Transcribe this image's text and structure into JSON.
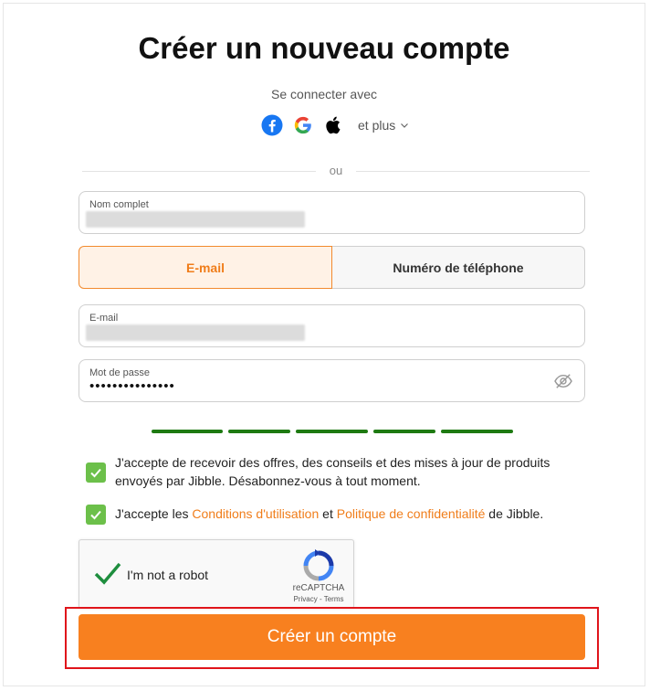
{
  "title": "Créer un nouveau compte",
  "social": {
    "connect_label": "Se connecter avec",
    "providers": [
      {
        "name": "Facebook",
        "icon": "facebook-icon",
        "color": "#1877F2"
      },
      {
        "name": "Google",
        "icon": "google-icon"
      },
      {
        "name": "Apple",
        "icon": "apple-icon",
        "color": "#000000"
      }
    ],
    "more_label": "et plus"
  },
  "divider_label": "ou",
  "full_name_field": {
    "label": "Nom complet"
  },
  "tabs": {
    "email_label": "E-mail",
    "phone_label": "Numéro de téléphone",
    "active": "email"
  },
  "email_field": {
    "label": "E-mail"
  },
  "password_field": {
    "label": "Mot de passe",
    "value": "•••••••••••••••"
  },
  "password_strength": {
    "segments_filled": 5,
    "segments_total": 5,
    "color": "#1E7A12"
  },
  "consents": {
    "marketing": {
      "text": "J'accepte de recevoir des offres, des conseils et des mises à jour de produits envoyés par Jibble. Désabonnez-vous à tout moment.",
      "checked": true
    },
    "terms": {
      "prefix": "J'accepte les ",
      "terms_link": "Conditions d'utilisation",
      "middle": " et ",
      "privacy_link": "Politique de confidentialité",
      "suffix": " de Jibble.",
      "checked": true
    }
  },
  "recaptcha": {
    "label": "I'm not a robot",
    "brand": "reCAPTCHA",
    "links": "Privacy - Terms",
    "checked": true
  },
  "submit": {
    "label": "Créer un compte"
  },
  "colors": {
    "accent": "#F8801F",
    "link": "#F07D1A",
    "checkbox": "#6CC04A",
    "highlight": "#E0151B"
  }
}
